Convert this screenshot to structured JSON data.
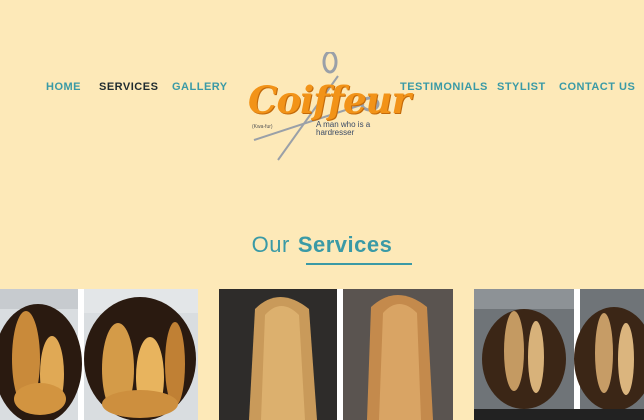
{
  "nav": {
    "home": "HOME",
    "services": "SERVICES",
    "gallery": "GALLERY",
    "testimonials": "TESTIMONIALS",
    "stylist": "STYLIST",
    "contact": "CONTACT US"
  },
  "logo": {
    "name": "Coiffeur",
    "small_text": "(Kwa-fur)",
    "tagline": "A man who is a hardresser",
    "icon": "scissors-icon"
  },
  "services_section": {
    "title_prefix": "Our",
    "title_main": "Services"
  },
  "colors": {
    "background": "#fde9b8",
    "accent": "#3a9aa6",
    "logo_orange": "#f29318",
    "active_nav": "#1e2b2f"
  }
}
